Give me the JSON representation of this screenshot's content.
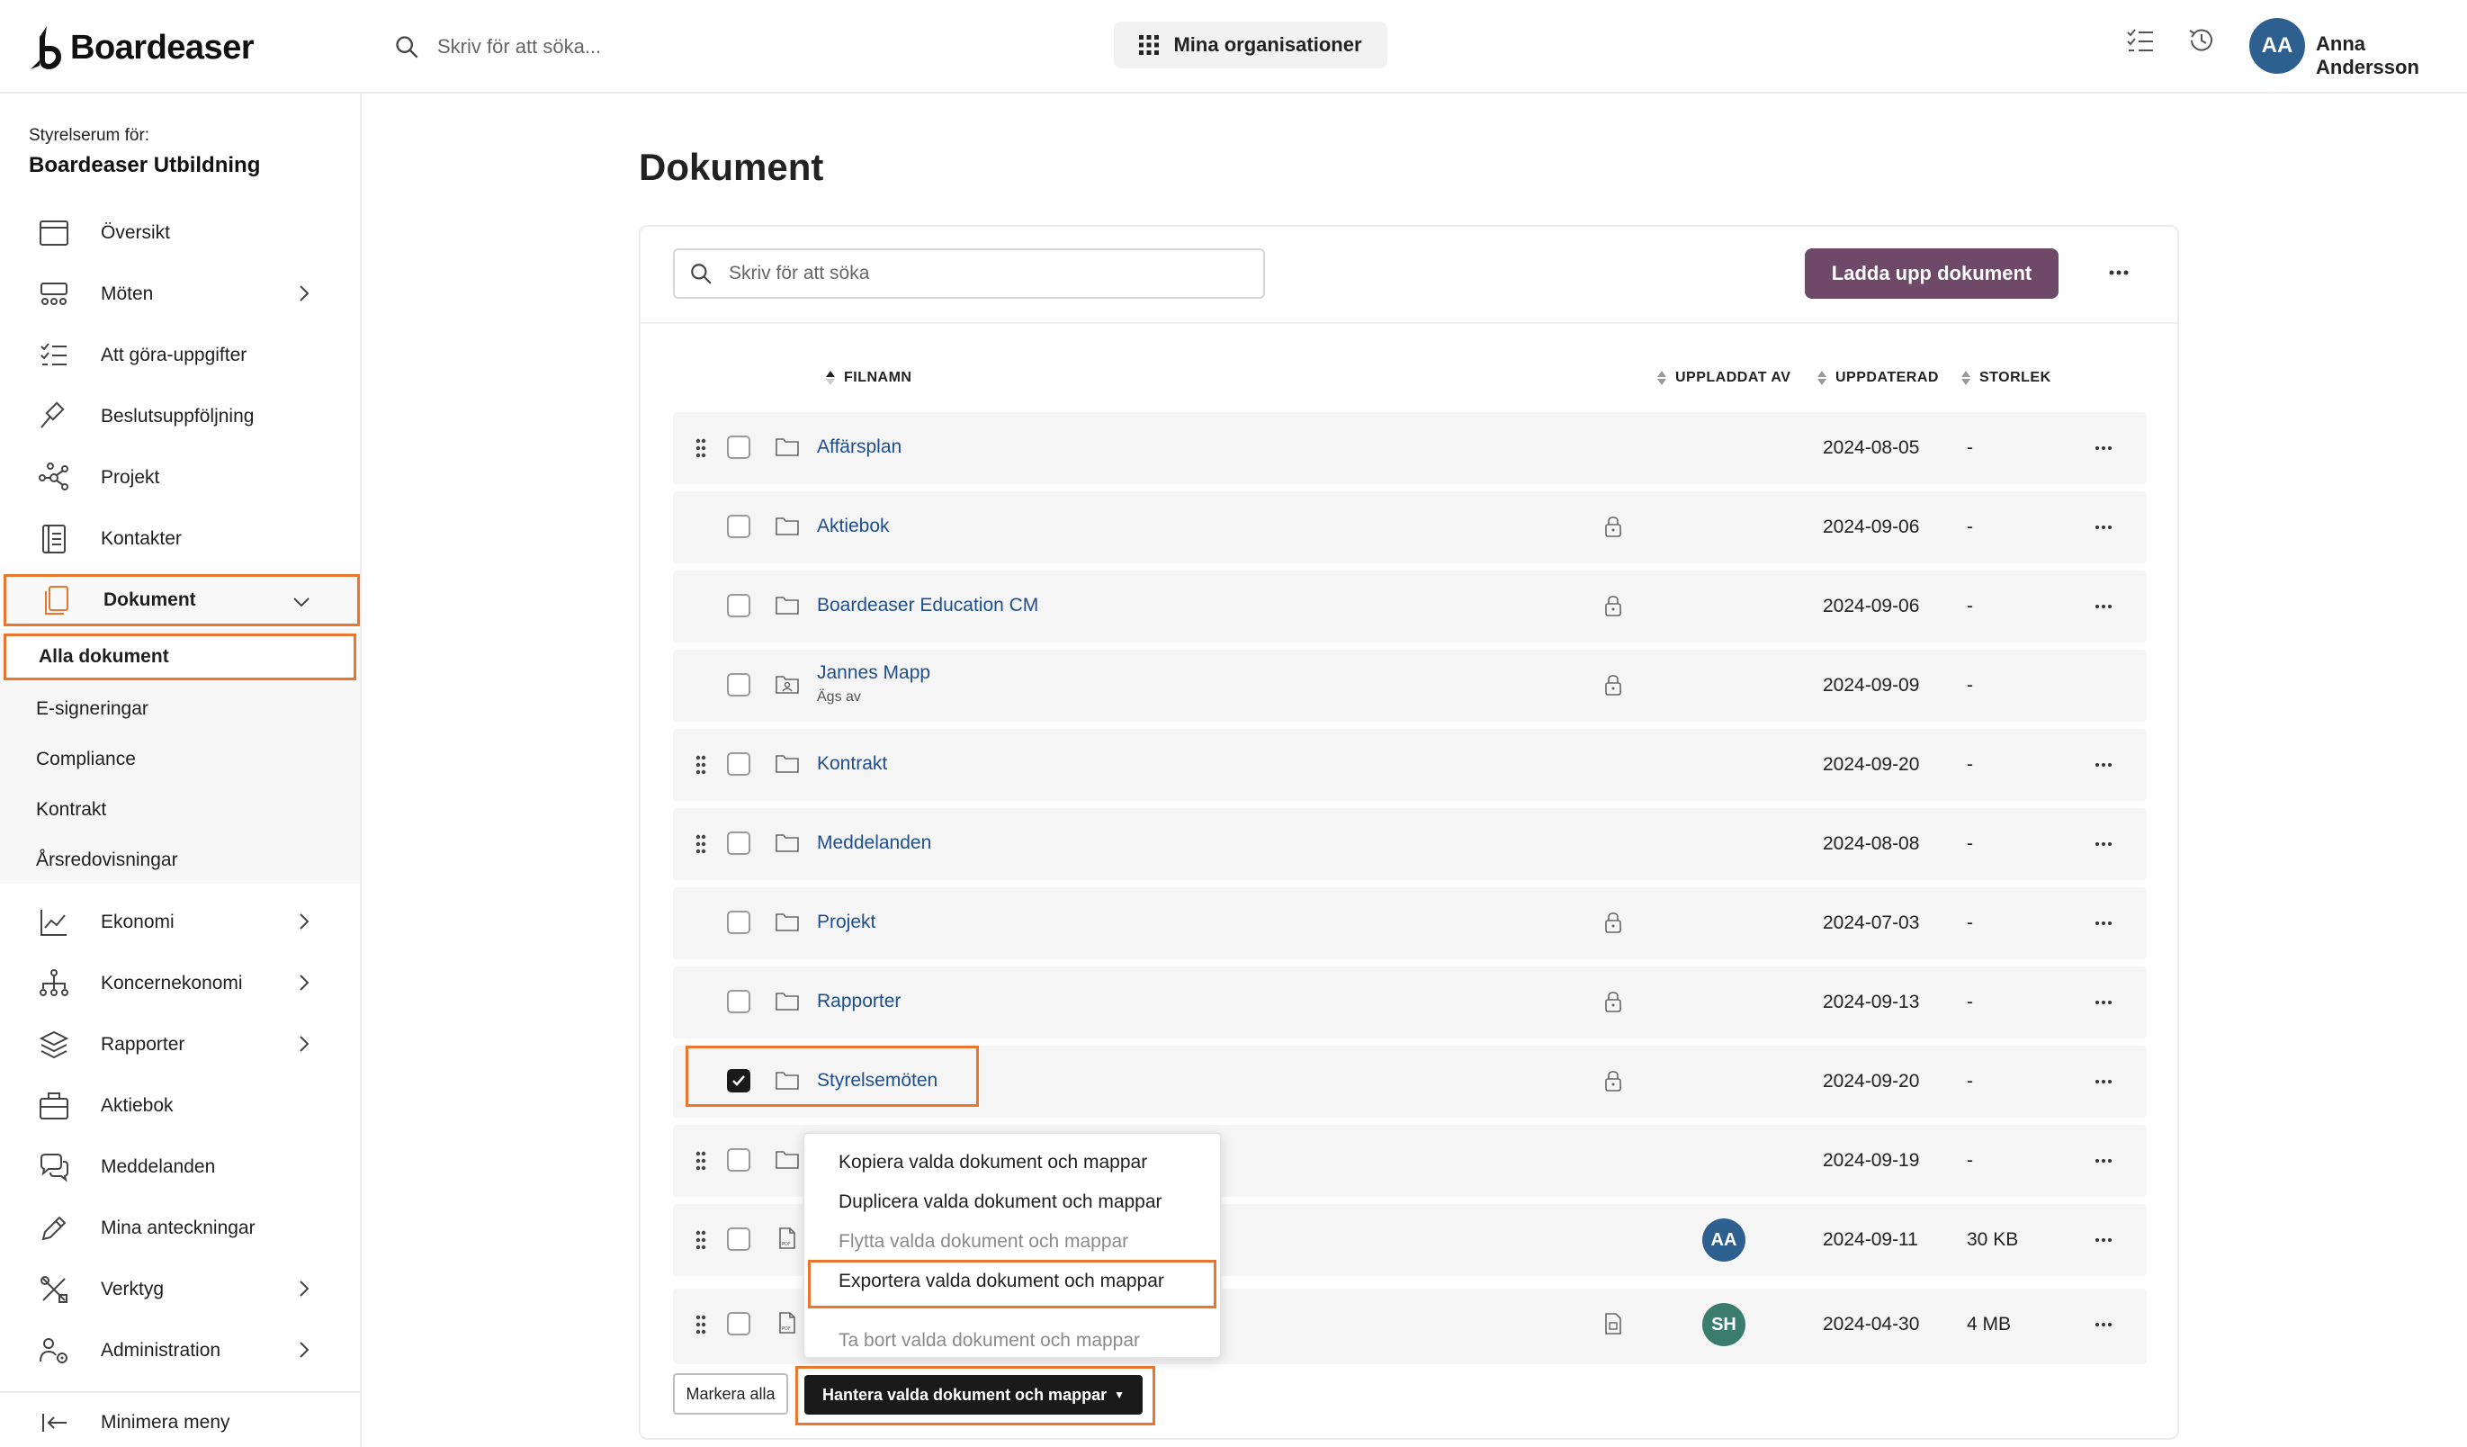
{
  "app": {
    "brand": "Boardeaser",
    "search_placeholder": "Skriv för att söka...",
    "org_button": "Mina organisationer",
    "user_initials": "AA",
    "user_name": "Anna Andersson"
  },
  "sidebar": {
    "label": "Styrelserum för:",
    "org_name": "Boardeaser Utbildning",
    "items": [
      {
        "label": "Översikt",
        "icon": "calendar-icon"
      },
      {
        "label": "Möten",
        "icon": "meeting-icon"
      },
      {
        "label": "Att göra-uppgifter",
        "icon": "checklist-icon"
      },
      {
        "label": "Beslutsuppföljning",
        "icon": "gavel-icon"
      },
      {
        "label": "Projekt",
        "icon": "network-icon"
      },
      {
        "label": "Kontakter",
        "icon": "contacts-icon"
      },
      {
        "label": "Dokument",
        "icon": "documents-icon"
      },
      {
        "label": "Ekonomi",
        "icon": "chart-icon"
      },
      {
        "label": "Koncernekonomi",
        "icon": "org-chart-icon"
      },
      {
        "label": "Rapporter",
        "icon": "layers-icon"
      },
      {
        "label": "Aktiebok",
        "icon": "briefcase-icon"
      },
      {
        "label": "Meddelanden",
        "icon": "chat-icon"
      },
      {
        "label": "Mina anteckningar",
        "icon": "pencil-icon"
      },
      {
        "label": "Verktyg",
        "icon": "tools-icon"
      },
      {
        "label": "Administration",
        "icon": "users-gear-icon"
      }
    ],
    "sub_items": [
      {
        "label": "Alla dokument"
      },
      {
        "label": "E-signeringar"
      },
      {
        "label": "Compliance"
      },
      {
        "label": "Kontrakt"
      },
      {
        "label": "Årsredovisningar"
      }
    ],
    "minimize": "Minimera meny"
  },
  "main": {
    "title": "Dokument",
    "search_placeholder": "Skriv för att söka",
    "upload_button": "Ladda upp dokument",
    "columns": {
      "filename": "FILNAMN",
      "uploaded_by": "UPPLADDAT AV",
      "updated": "UPPDATERAD",
      "size": "STORLEK"
    },
    "rows": [
      {
        "name": "Affärsplan",
        "sub": "",
        "date": "2024-08-05",
        "size": "-",
        "lock": false,
        "drag": true,
        "checked": false,
        "avatar": "",
        "file": false
      },
      {
        "name": "Aktiebok",
        "sub": "",
        "date": "2024-09-06",
        "size": "-",
        "lock": true,
        "drag": false,
        "checked": false,
        "avatar": "",
        "file": false
      },
      {
        "name": "Boardeaser Education CM",
        "sub": "",
        "date": "2024-09-06",
        "size": "-",
        "lock": true,
        "drag": false,
        "checked": false,
        "avatar": "",
        "file": false
      },
      {
        "name": "Jannes Mapp",
        "sub": "Ägs av",
        "date": "2024-09-09",
        "size": "-",
        "lock": true,
        "drag": false,
        "checked": false,
        "avatar": "",
        "file": false
      },
      {
        "name": "Kontrakt",
        "sub": "",
        "date": "2024-09-20",
        "size": "-",
        "lock": false,
        "drag": true,
        "checked": false,
        "avatar": "",
        "file": false
      },
      {
        "name": "Meddelanden",
        "sub": "",
        "date": "2024-08-08",
        "size": "-",
        "lock": false,
        "drag": true,
        "checked": false,
        "avatar": "",
        "file": false
      },
      {
        "name": "Projekt",
        "sub": "",
        "date": "2024-07-03",
        "size": "-",
        "lock": true,
        "drag": false,
        "checked": false,
        "avatar": "",
        "file": false
      },
      {
        "name": "Rapporter",
        "sub": "",
        "date": "2024-09-13",
        "size": "-",
        "lock": true,
        "drag": false,
        "checked": false,
        "avatar": "",
        "file": false
      },
      {
        "name": "Styrelsemöten",
        "sub": "",
        "date": "2024-09-20",
        "size": "-",
        "lock": true,
        "drag": false,
        "checked": true,
        "avatar": "",
        "file": false
      },
      {
        "name": "",
        "sub": "",
        "date": "2024-09-19",
        "size": "-",
        "lock": false,
        "drag": true,
        "checked": false,
        "avatar": "",
        "file": false
      },
      {
        "name": "",
        "sub": "",
        "date": "2024-09-11",
        "size": "30 KB",
        "lock": false,
        "drag": true,
        "checked": false,
        "avatar": "AA",
        "file": true
      },
      {
        "name": "",
        "sub": "",
        "date": "2024-04-30",
        "size": "4 MB",
        "lock": false,
        "drag": true,
        "checked": false,
        "avatar": "SH",
        "file": true,
        "doc": true
      }
    ],
    "menu": {
      "items": [
        {
          "label": "Kopiera valda dokument och mappar",
          "disabled": false
        },
        {
          "label": "Duplicera valda dokument och mappar",
          "disabled": false
        },
        {
          "label": "Flytta valda dokument och mappar",
          "disabled": true
        },
        {
          "label": "Exportera valda dokument och mappar",
          "disabled": false
        },
        {
          "label": "Ta bort valda dokument och mappar",
          "disabled": true
        }
      ]
    },
    "mark_all": "Markera alla",
    "manage_button": "Hantera valda dokument och mappar"
  },
  "colors": {
    "accent_highlight": "#e8762e",
    "primary_button": "#6e4a68",
    "link": "#1f4e8c",
    "avatar_blue": "#2d5f8f",
    "avatar_green": "#3a7d6e"
  }
}
